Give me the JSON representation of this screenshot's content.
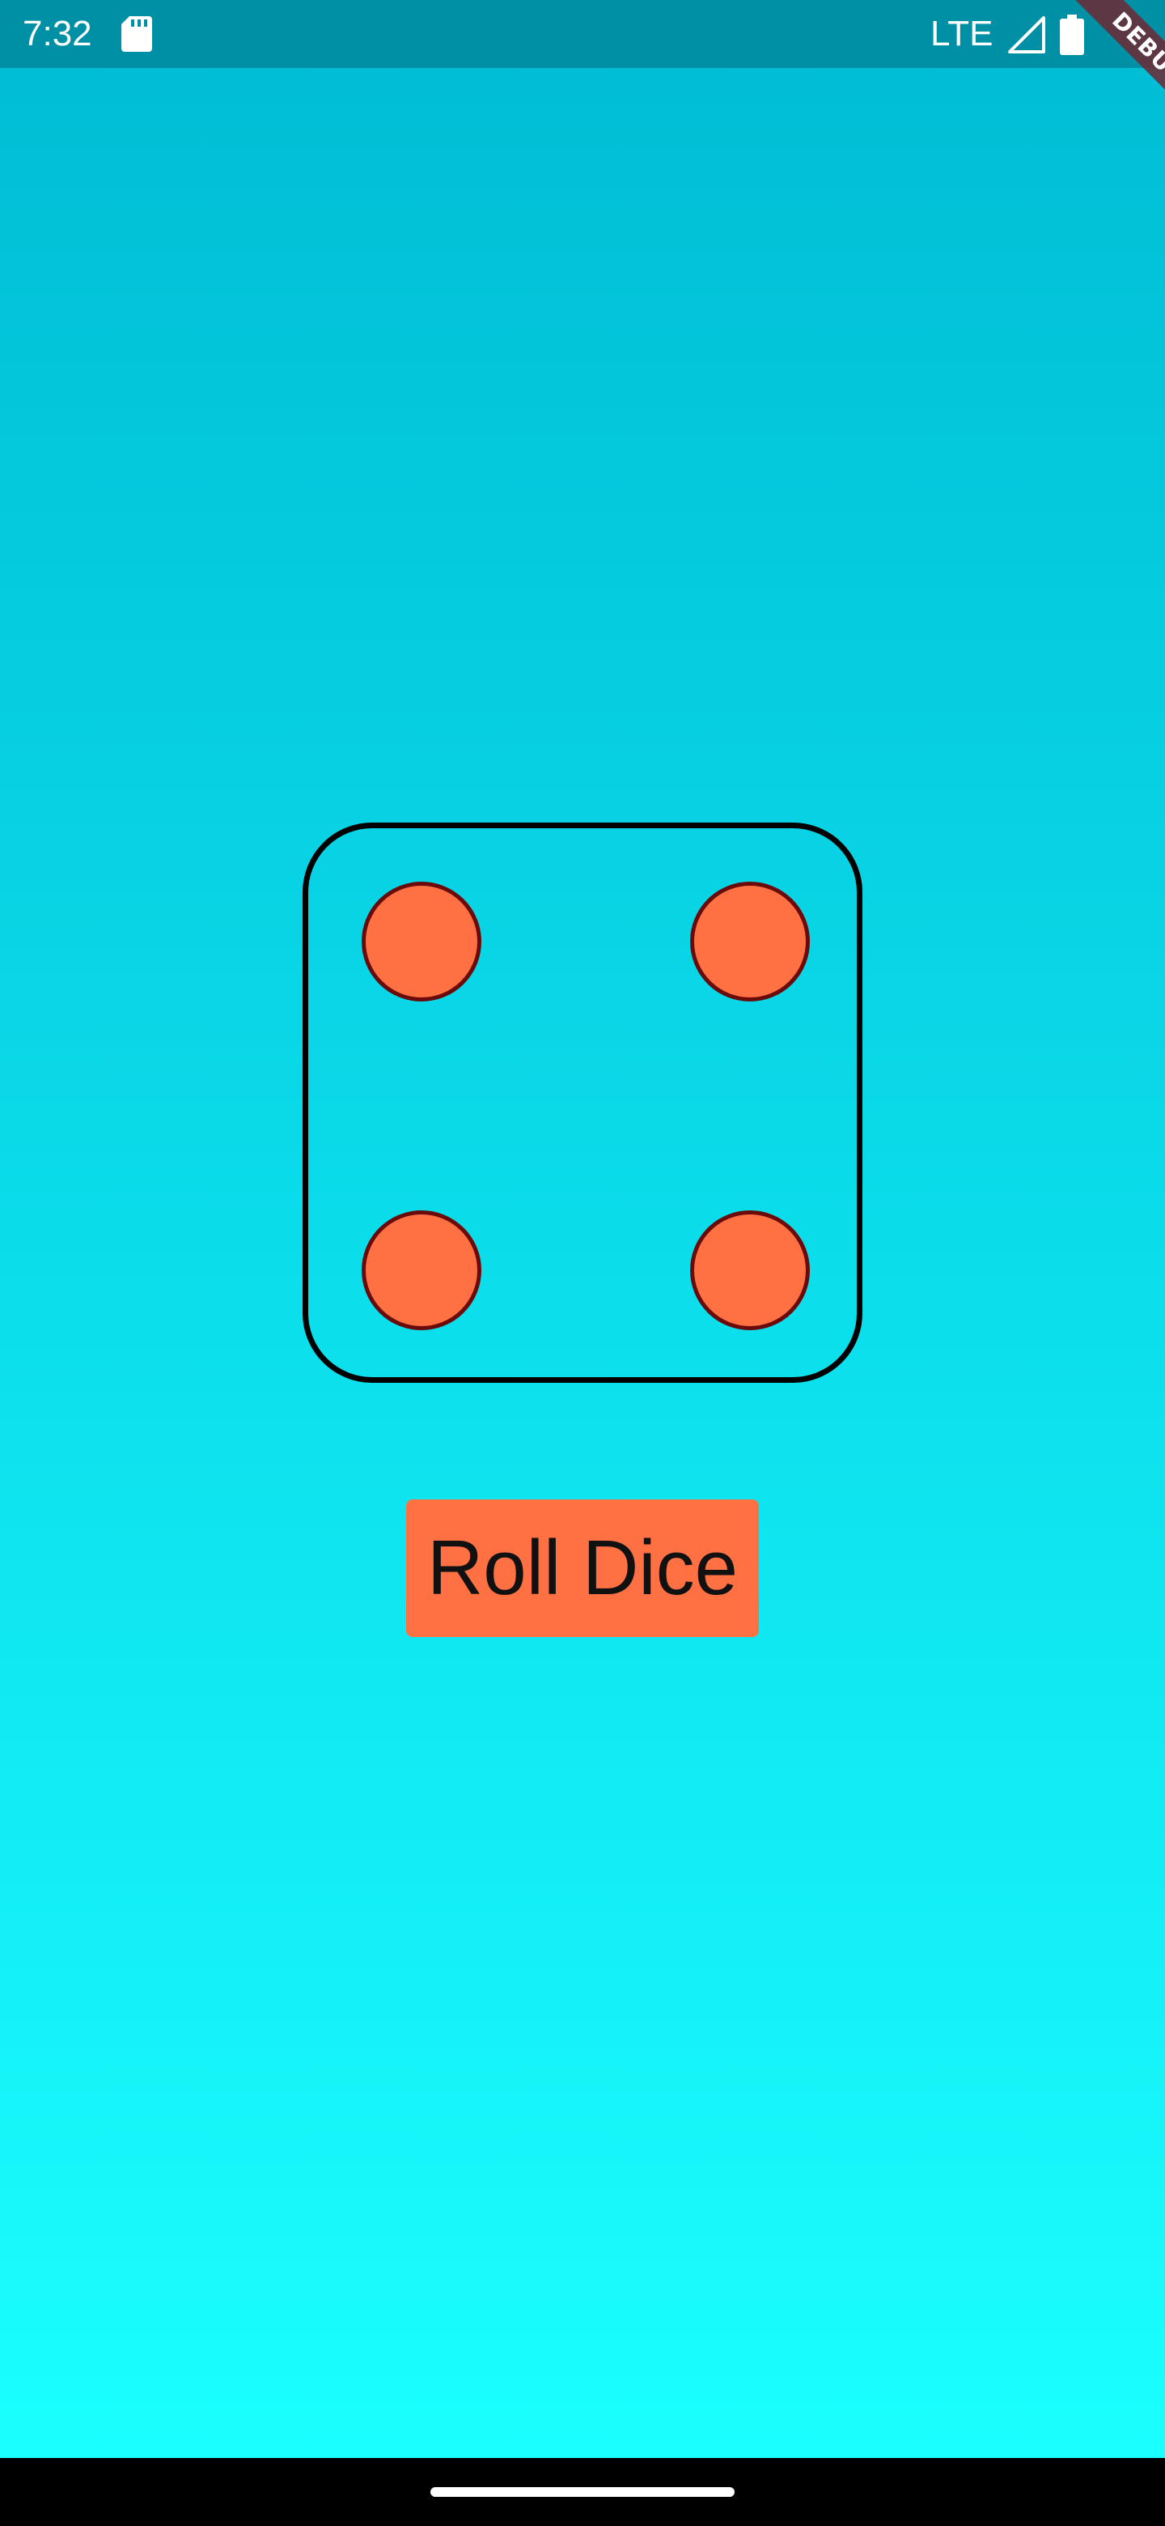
{
  "status_bar": {
    "time": "7:32",
    "network": "LTE",
    "icons": [
      "sd-card-icon",
      "signal-icon",
      "battery-icon"
    ]
  },
  "debug_banner": {
    "label": "DEBUG"
  },
  "dice": {
    "face_value": 4,
    "pip_color": "#ff7043",
    "pip_border_color": "#6b0a0a",
    "border_color": "#000000"
  },
  "roll_button": {
    "label": "Roll Dice",
    "color": "#ff7043"
  },
  "theme": {
    "gradient_top": "#00bcd4",
    "gradient_bottom": "#1affff",
    "status_bar_color": "#0090a6"
  },
  "nav_bar": {
    "icons": [
      "home-handle-icon"
    ]
  }
}
